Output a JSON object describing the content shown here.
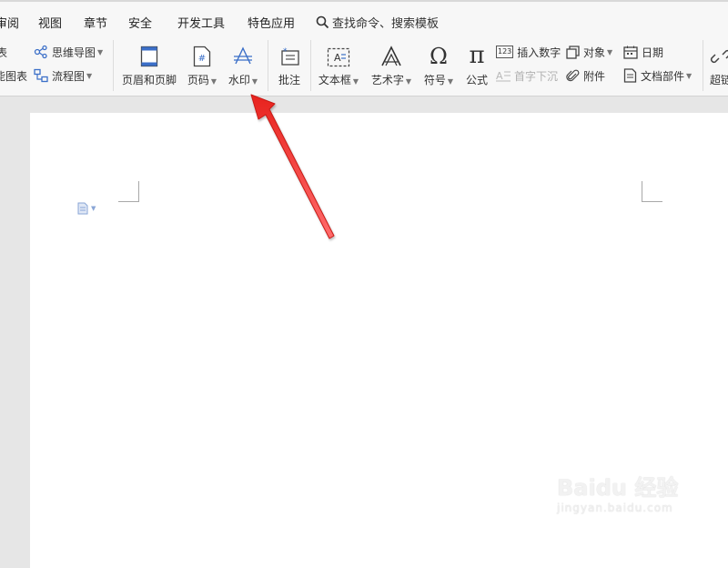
{
  "menu": {
    "items": [
      "审阅",
      "视图",
      "章节",
      "安全",
      "开发工具",
      "特色应用"
    ],
    "search_label": "查找命令、搜索模板"
  },
  "ribbon": {
    "left_partial": {
      "top_label": "表",
      "bottom_label": "能图表"
    },
    "mindmap_label": "思维导图",
    "flowchart_label": "流程图",
    "header_footer_label": "页眉和页脚",
    "page_number_label": "页码",
    "watermark_label": "水印",
    "comment_label": "批注",
    "textbox_label": "文本框",
    "wordart_label": "艺术字",
    "symbol_label": "符号",
    "formula_label": "公式",
    "insert_number_label": "插入数字",
    "insert_number_icon_text": "123",
    "drop_cap_label": "首字下沉",
    "object_label": "对象",
    "attachment_label": "附件",
    "date_label": "日期",
    "doc_parts_label": "文档部件",
    "hyperlink_partial_label": "超链"
  },
  "watermark_overlay": {
    "logo_text": "Baidu 经验",
    "url_text": "jingyan.baidu.com"
  },
  "colors": {
    "accent_blue": "#3b6fc8",
    "annotation_arrow": "#e8231e"
  }
}
